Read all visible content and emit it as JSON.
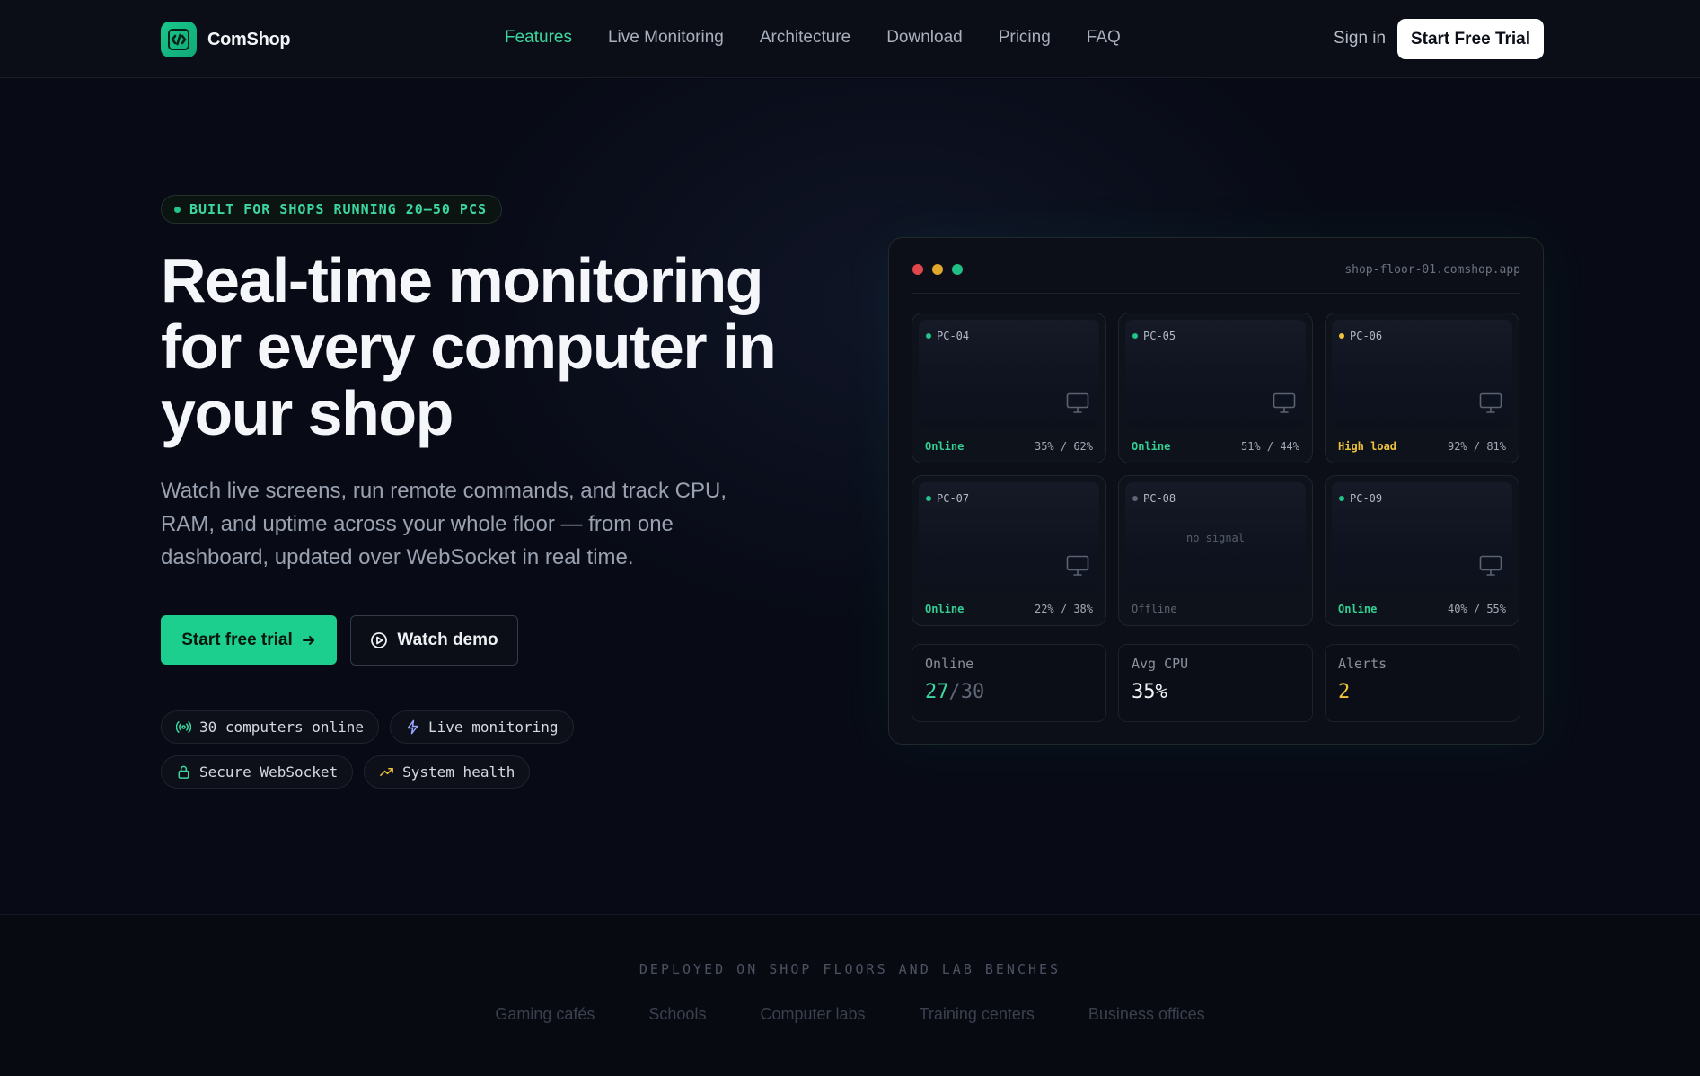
{
  "brand": {
    "name": "ComShop"
  },
  "nav": {
    "links": [
      "Features",
      "Live Monitoring",
      "Architecture",
      "Download",
      "Pricing",
      "FAQ"
    ],
    "signin": "Sign in",
    "cta": "Start Free Trial"
  },
  "hero": {
    "badge": "BUILT FOR SHOPS RUNNING 20–50 PCS",
    "headline": "Real-time monitoring for every computer in your shop",
    "subtext": "Watch live screens, run remote commands, and track CPU, RAM, and uptime across your whole floor — from one dashboard, updated over WebSocket in real time.",
    "primary_cta": "Start free trial",
    "secondary_cta": "Watch demo",
    "pills": [
      {
        "icon": "signal-icon",
        "label": "30 computers online"
      },
      {
        "icon": "lightning-icon",
        "label": "Live monitoring"
      },
      {
        "icon": "lock-icon",
        "label": "Secure WebSocket"
      },
      {
        "icon": "trend-up-icon",
        "label": "System health"
      }
    ]
  },
  "dashboard": {
    "url": "shop-floor-01.comshop.app",
    "pcs": [
      {
        "name": "PC-04",
        "status": "Online",
        "metric": "35% / 62%",
        "state": "online",
        "dot_color": "#22c48a"
      },
      {
        "name": "PC-05",
        "status": "Online",
        "metric": "51% / 44%",
        "state": "online",
        "dot_color": "#22c48a"
      },
      {
        "name": "PC-06",
        "status": "High load",
        "metric": "92% / 81%",
        "state": "warn",
        "dot_color": "#f0c23c"
      },
      {
        "name": "PC-07",
        "status": "Online",
        "metric": "22% / 38%",
        "state": "online",
        "dot_color": "#22c48a"
      },
      {
        "name": "PC-08",
        "status": "Offline",
        "metric": "",
        "state": "off",
        "dot_color": "#5e6573",
        "screen_text": "no signal"
      },
      {
        "name": "PC-09",
        "status": "Online",
        "metric": "40% / 55%",
        "state": "online",
        "dot_color": "#22c48a"
      }
    ],
    "stats": {
      "online_label": "Online",
      "online_count": "27",
      "online_total": "/30",
      "cpu_label": "Avg CPU",
      "cpu_value": "35%",
      "alerts_label": "Alerts",
      "alerts_value": "2"
    }
  },
  "deployed": {
    "title": "DEPLOYED ON SHOP FLOORS AND LAB BENCHES",
    "items": [
      "Gaming cafés",
      "Schools",
      "Computer labs",
      "Training centers",
      "Business offices"
    ]
  },
  "colors": {
    "accent": "#1ccf8f",
    "warning": "#f0c23c",
    "background": "#080b16"
  }
}
